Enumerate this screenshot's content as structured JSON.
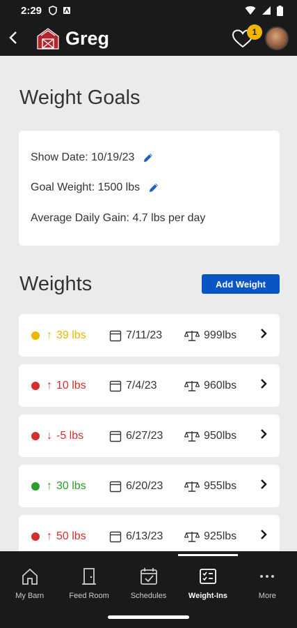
{
  "status_bar": {
    "time": "2:29"
  },
  "app_bar": {
    "title": "Greg",
    "notification_count": "1"
  },
  "goals": {
    "heading": "Weight Goals",
    "show_date": "Show Date: 10/19/23",
    "goal_weight": "Goal Weight: 1500 lbs",
    "avg_daily_gain": "Average Daily Gain: 4.7 lbs per day"
  },
  "weights": {
    "heading": "Weights",
    "add_button": "Add Weight",
    "entries": [
      {
        "arrow": "↑",
        "gain": "39 lbs",
        "date": "7/11/23",
        "weight": "999lbs",
        "color": "#f0b400"
      },
      {
        "arrow": "↑",
        "gain": "10 lbs",
        "date": "7/4/23",
        "weight": "960lbs",
        "color": "#d32f2f"
      },
      {
        "arrow": "↓",
        "gain": "-5 lbs",
        "date": "6/27/23",
        "weight": "950lbs",
        "color": "#d32f2f"
      },
      {
        "arrow": "↑",
        "gain": "30 lbs",
        "date": "6/20/23",
        "weight": "955lbs",
        "color": "#2e9d2e"
      },
      {
        "arrow": "↑",
        "gain": "50 lbs",
        "date": "6/13/23",
        "weight": "925lbs",
        "color": "#d32f2f"
      }
    ]
  },
  "nav": {
    "items": [
      {
        "label": "My Barn",
        "icon": "home-icon"
      },
      {
        "label": "Feed Room",
        "icon": "door-icon"
      },
      {
        "label": "Schedules",
        "icon": "calendar-check-icon"
      },
      {
        "label": "Weight-Ins",
        "icon": "list-icon"
      },
      {
        "label": "More",
        "icon": "more-icon"
      }
    ],
    "active_index": 3
  }
}
